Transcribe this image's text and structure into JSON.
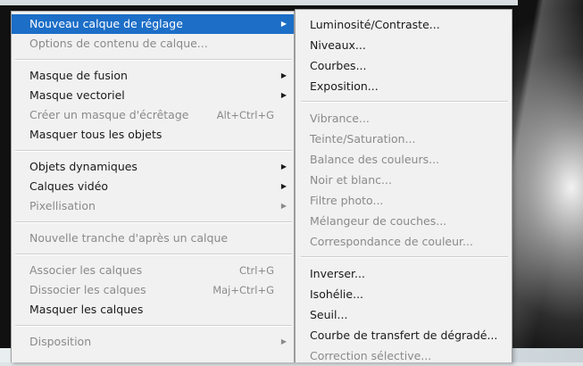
{
  "main_menu": {
    "groups": [
      [
        {
          "label": "Nouveau calque de réglage",
          "shortcut": "",
          "submenu": true,
          "disabled": false,
          "highlighted": true
        },
        {
          "label": "Options de contenu de calque...",
          "shortcut": "",
          "submenu": false,
          "disabled": true,
          "highlighted": false
        }
      ],
      [
        {
          "label": "Masque de fusion",
          "shortcut": "",
          "submenu": true,
          "disabled": false,
          "highlighted": false
        },
        {
          "label": "Masque vectoriel",
          "shortcut": "",
          "submenu": true,
          "disabled": false,
          "highlighted": false
        },
        {
          "label": "Créer un masque d'écrêtage",
          "shortcut": "Alt+Ctrl+G",
          "submenu": false,
          "disabled": true,
          "highlighted": false
        },
        {
          "label": "Masquer tous les objets",
          "shortcut": "",
          "submenu": false,
          "disabled": false,
          "highlighted": false
        }
      ],
      [
        {
          "label": "Objets dynamiques",
          "shortcut": "",
          "submenu": true,
          "disabled": false,
          "highlighted": false
        },
        {
          "label": "Calques vidéo",
          "shortcut": "",
          "submenu": true,
          "disabled": false,
          "highlighted": false
        },
        {
          "label": "Pixellisation",
          "shortcut": "",
          "submenu": true,
          "disabled": true,
          "highlighted": false
        }
      ],
      [
        {
          "label": "Nouvelle tranche d'après un calque",
          "shortcut": "",
          "submenu": false,
          "disabled": true,
          "highlighted": false
        }
      ],
      [
        {
          "label": "Associer les calques",
          "shortcut": "Ctrl+G",
          "submenu": false,
          "disabled": true,
          "highlighted": false
        },
        {
          "label": "Dissocier les calques",
          "shortcut": "Maj+Ctrl+G",
          "submenu": false,
          "disabled": true,
          "highlighted": false
        },
        {
          "label": "Masquer les calques",
          "shortcut": "",
          "submenu": false,
          "disabled": false,
          "highlighted": false
        }
      ],
      [
        {
          "label": "Disposition",
          "shortcut": "",
          "submenu": true,
          "disabled": true,
          "highlighted": false
        }
      ]
    ]
  },
  "submenu": {
    "groups": [
      [
        {
          "label": "Luminosité/Contraste...",
          "disabled": false
        },
        {
          "label": "Niveaux...",
          "disabled": false
        },
        {
          "label": "Courbes...",
          "disabled": false
        },
        {
          "label": "Exposition...",
          "disabled": false
        }
      ],
      [
        {
          "label": "Vibrance...",
          "disabled": true
        },
        {
          "label": "Teinte/Saturation...",
          "disabled": true
        },
        {
          "label": "Balance des couleurs...",
          "disabled": true
        },
        {
          "label": "Noir et blanc...",
          "disabled": true
        },
        {
          "label": "Filtre photo...",
          "disabled": true
        },
        {
          "label": "Mélangeur de couches...",
          "disabled": true
        },
        {
          "label": "Correspondance de couleur...",
          "disabled": true
        }
      ],
      [
        {
          "label": "Inverser...",
          "disabled": false
        },
        {
          "label": "Isohélie...",
          "disabled": false
        },
        {
          "label": "Seuil...",
          "disabled": false
        },
        {
          "label": "Courbe de transfert de dégradé...",
          "disabled": false
        },
        {
          "label": "Correction sélective...",
          "disabled": true
        }
      ]
    ]
  },
  "colors": {
    "highlight": "#1c6ec7",
    "menu_bg": "#f1f1f1",
    "disabled_text": "#8a8a8a",
    "text": "#1a1a1a"
  },
  "icons": {
    "submenu_arrow": "submenu-arrow-icon"
  }
}
